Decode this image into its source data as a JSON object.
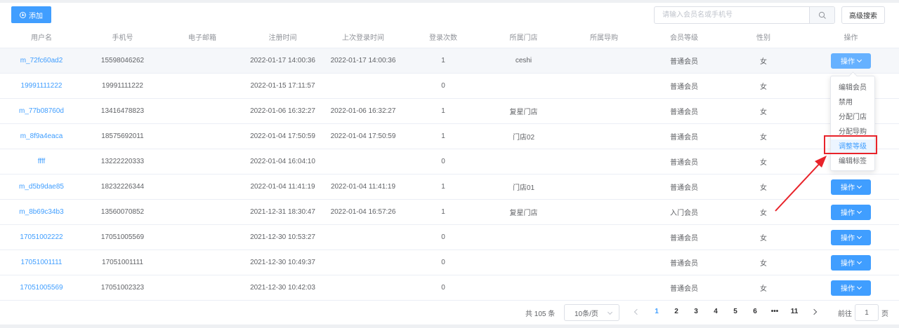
{
  "toolbar": {
    "add_label": "添加",
    "search_placeholder": "请输入会员名或手机号",
    "advanced_search_label": "高级搜索"
  },
  "table": {
    "columns": [
      "用户名",
      "手机号",
      "电子邮箱",
      "注册时间",
      "上次登录时间",
      "登录次数",
      "所属门店",
      "所属导购",
      "会员等级",
      "性别",
      "操作"
    ],
    "rows": [
      {
        "username": "m_72fc60ad2",
        "phone": "15598046262",
        "email": "",
        "reg_time": "2022-01-17 14:00:36",
        "last_login": "2022-01-17 14:00:36",
        "login_count": "1",
        "store": "ceshi",
        "guide": "",
        "level": "普通会员",
        "gender": "女",
        "op": "操作"
      },
      {
        "username": "19991111222",
        "phone": "19991111222",
        "email": "",
        "reg_time": "2022-01-15 17:11:57",
        "last_login": "",
        "login_count": "0",
        "store": "",
        "guide": "",
        "level": "普通会员",
        "gender": "女",
        "op": "操作"
      },
      {
        "username": "m_77b08760d",
        "phone": "13416478823",
        "email": "",
        "reg_time": "2022-01-06 16:32:27",
        "last_login": "2022-01-06 16:32:27",
        "login_count": "1",
        "store": "复星门店",
        "guide": "",
        "level": "普通会员",
        "gender": "女",
        "op": "操作"
      },
      {
        "username": "m_8f9a4eaca",
        "phone": "18575692011",
        "email": "",
        "reg_time": "2022-01-04 17:50:59",
        "last_login": "2022-01-04 17:50:59",
        "login_count": "1",
        "store": "门店02",
        "guide": "",
        "level": "普通会员",
        "gender": "女",
        "op": "操作"
      },
      {
        "username": "ffff",
        "phone": "13222220333",
        "email": "",
        "reg_time": "2022-01-04 16:04:10",
        "last_login": "",
        "login_count": "0",
        "store": "",
        "guide": "",
        "level": "普通会员",
        "gender": "女",
        "op": "操作"
      },
      {
        "username": "m_d5b9dae85",
        "phone": "18232226344",
        "email": "",
        "reg_time": "2022-01-04 11:41:19",
        "last_login": "2022-01-04 11:41:19",
        "login_count": "1",
        "store": "门店01",
        "guide": "",
        "level": "普通会员",
        "gender": "女",
        "op": "操作"
      },
      {
        "username": "m_8b69c34b3",
        "phone": "13560070852",
        "email": "",
        "reg_time": "2021-12-31 18:30:47",
        "last_login": "2022-01-04 16:57:26",
        "login_count": "1",
        "store": "复星门店",
        "guide": "",
        "level": "入门会员",
        "gender": "女",
        "op": "操作"
      },
      {
        "username": "17051002222",
        "phone": "17051005569",
        "email": "",
        "reg_time": "2021-12-30 10:53:27",
        "last_login": "",
        "login_count": "0",
        "store": "",
        "guide": "",
        "level": "普通会员",
        "gender": "女",
        "op": "操作"
      },
      {
        "username": "17051001111",
        "phone": "17051001111",
        "email": "",
        "reg_time": "2021-12-30 10:49:37",
        "last_login": "",
        "login_count": "0",
        "store": "",
        "guide": "",
        "level": "普通会员",
        "gender": "女",
        "op": "操作"
      },
      {
        "username": "17051005569",
        "phone": "17051002323",
        "email": "",
        "reg_time": "2021-12-30 10:42:03",
        "last_login": "",
        "login_count": "0",
        "store": "",
        "guide": "",
        "level": "普通会员",
        "gender": "女",
        "op": "操作"
      }
    ]
  },
  "dropdown": {
    "items": [
      "编辑会员",
      "禁用",
      "分配门店",
      "分配导购",
      "调整等级",
      "编辑标签"
    ],
    "active_index": 4
  },
  "pagination": {
    "total_label": "共 105 条",
    "page_size": "10条/页",
    "pages": [
      "1",
      "2",
      "3",
      "4",
      "5",
      "6",
      "•••",
      "11"
    ],
    "current_page": "1",
    "goto_prefix": "前往",
    "goto_value": "1",
    "goto_suffix": "页"
  },
  "colors": {
    "primary": "#409eff",
    "highlight": "#e8232a"
  }
}
